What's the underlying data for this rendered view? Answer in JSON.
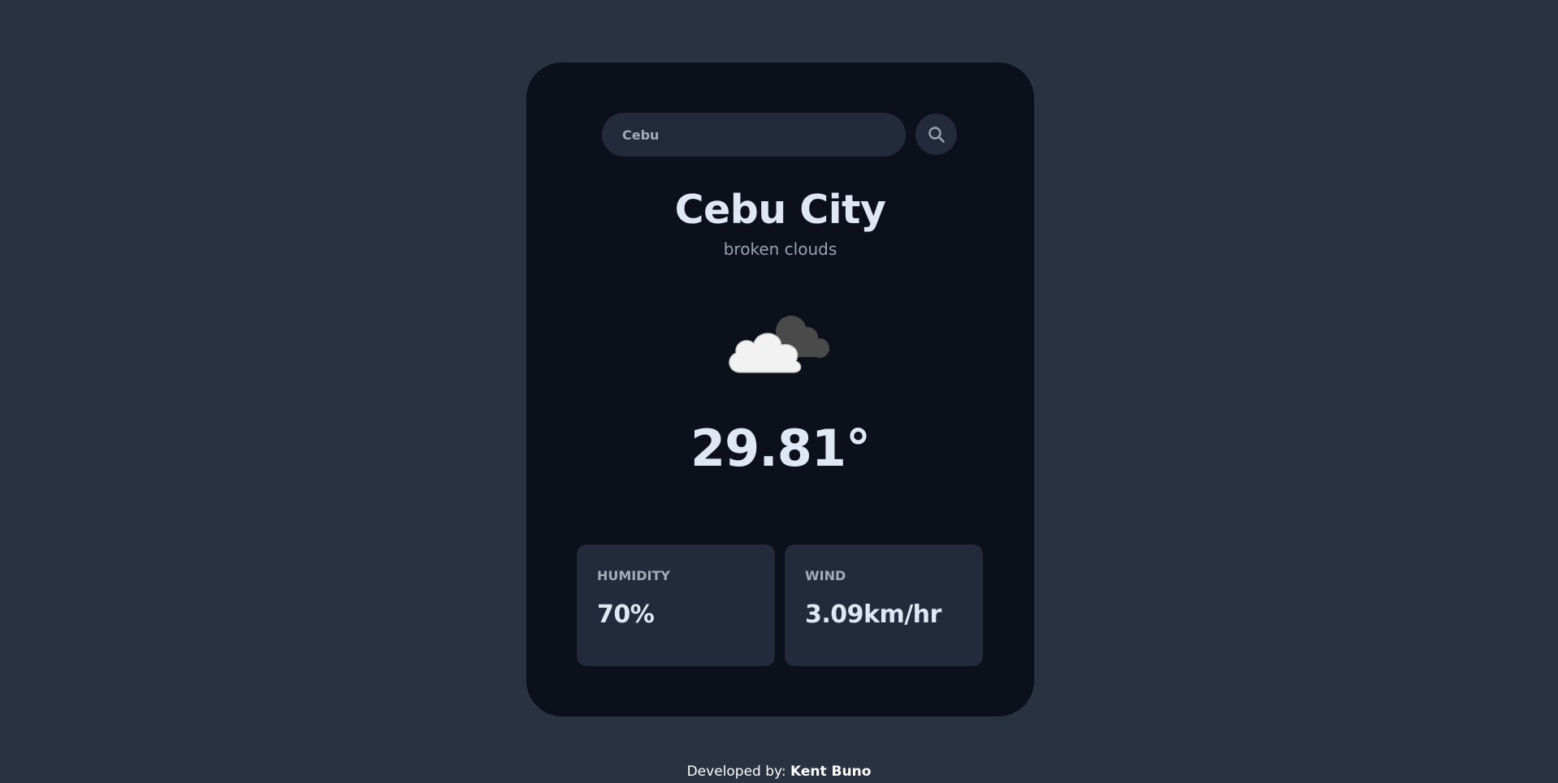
{
  "search": {
    "value": "Cebu",
    "icon": "search-icon"
  },
  "weather": {
    "city": "Cebu City",
    "description": "broken clouds",
    "icon": "broken-clouds-icon",
    "temperature": "29.81°"
  },
  "stats": {
    "humidity": {
      "label": "HUMIDITY",
      "value": "70%"
    },
    "wind": {
      "label": "WIND",
      "value": "3.09km/hr"
    }
  },
  "footer": {
    "prefix": "Developed by:",
    "author": "Kent Buno"
  },
  "colors": {
    "page_background": "#283241",
    "card_background": "#0b101b",
    "panel_background": "#232a3b",
    "primary_text": "#dfe7f4",
    "muted_text": "#9aa3b3"
  }
}
